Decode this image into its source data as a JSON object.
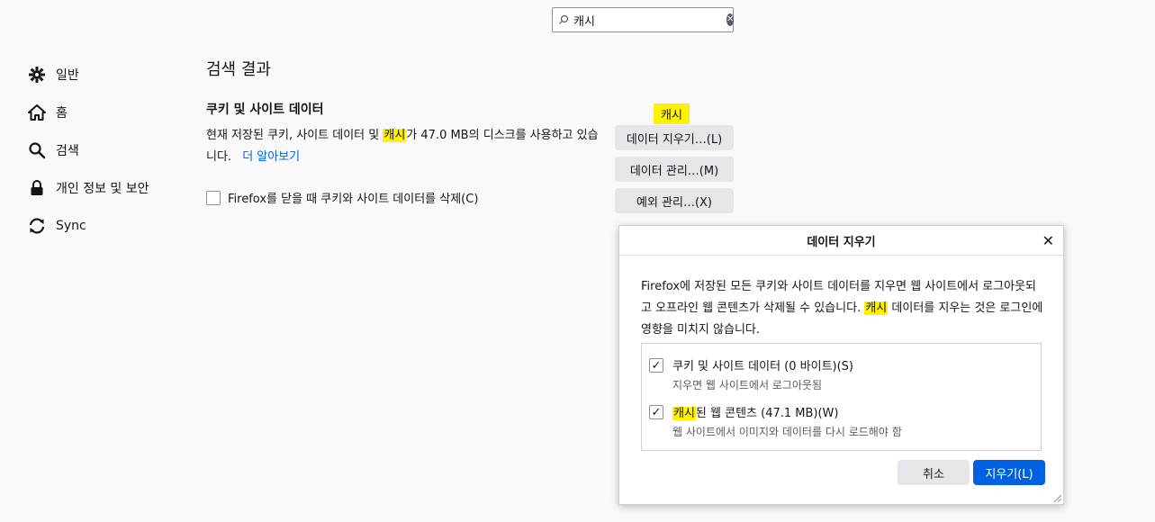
{
  "search": {
    "value": "캐시",
    "placeholder": ""
  },
  "sidebar": {
    "items": [
      {
        "label": "일반",
        "icon": "gear-icon"
      },
      {
        "label": "홈",
        "icon": "home-icon"
      },
      {
        "label": "검색",
        "icon": "search-icon"
      },
      {
        "label": "개인 정보 및 보안",
        "icon": "lock-icon"
      },
      {
        "label": "Sync",
        "icon": "sync-icon"
      }
    ]
  },
  "main": {
    "page_title": "검색 결과",
    "section_title": "쿠키 및 사이트 데이터",
    "desc_before": "현재 저장된 쿠키, 사이트 데이터 및 ",
    "desc_highlight": "캐시",
    "desc_after": "가 47.0 MB의 디스크를 사용하고 있습니다.",
    "learn_more": "더 알아보기",
    "delete_on_close_label": "Firefox를 닫을 때 쿠키와 사이트 데이터를 삭제(C)",
    "cache_tag": "캐시",
    "clear_data_button": "데이터 지우기…(L)",
    "manage_data_button": "데이터 관리…(M)",
    "exceptions_button": "예외 관리…(X)"
  },
  "dialog": {
    "title": "데이터 지우기",
    "desc_before": "Firefox에 저장된 모든 쿠키와 사이트 데이터를 지우면 웹 사이트에서 로그아웃되고 오프라인 웹 콘텐츠가 삭제될 수 있습니다. ",
    "desc_highlight": "캐시",
    "desc_after": " 데이터를 지우는 것은 로그인에 영향을 미치지 않습니다.",
    "option1_label": "쿠키 및 사이트 데이터 (0 바이트)(S)",
    "option1_sub": "지우면 웹 사이트에서 로그아웃됨",
    "option2_highlight": "캐시",
    "option2_label": "된 웹 콘텐츠 (47.1 MB)(W)",
    "option2_sub": "웹 사이트에서 이미지와 데이터를 다시 로드해야 함",
    "cancel_button": "취소",
    "ok_button": "지우기(L)"
  }
}
